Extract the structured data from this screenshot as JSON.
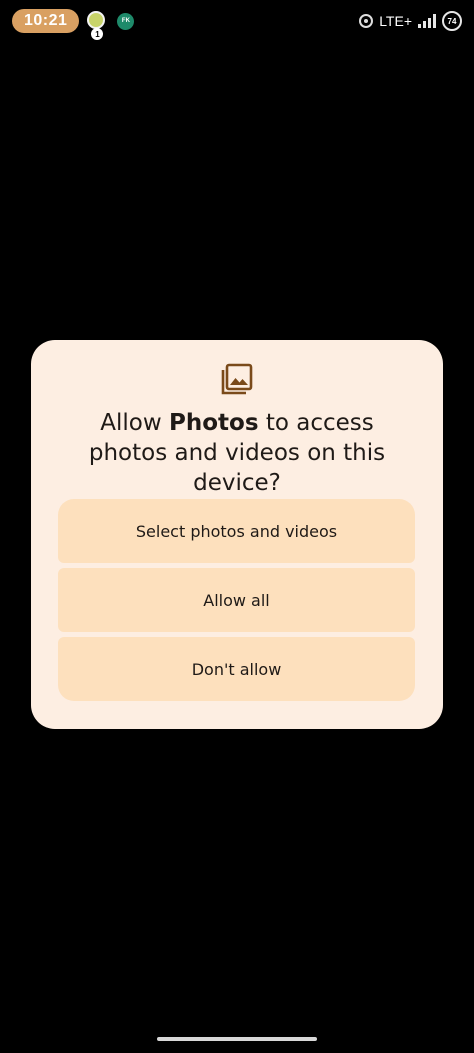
{
  "status_bar": {
    "time": "10:21",
    "notification_badge_count": "1",
    "second_notification_label": "FK",
    "network": "LTE+",
    "battery": "74"
  },
  "dialog": {
    "icon": "photo-library-icon",
    "title_prefix": "Allow ",
    "title_app": "Photos",
    "title_suffix": " to access photos and videos on this device?",
    "buttons": [
      {
        "label": "Select photos and videos"
      },
      {
        "label": "Allow all"
      },
      {
        "label": "Don't allow"
      }
    ]
  },
  "colors": {
    "dialog_bg": "#fdeee2",
    "button_bg": "#fde0bd",
    "icon_color": "#7a4a1a",
    "time_pill": "#d9a062"
  }
}
